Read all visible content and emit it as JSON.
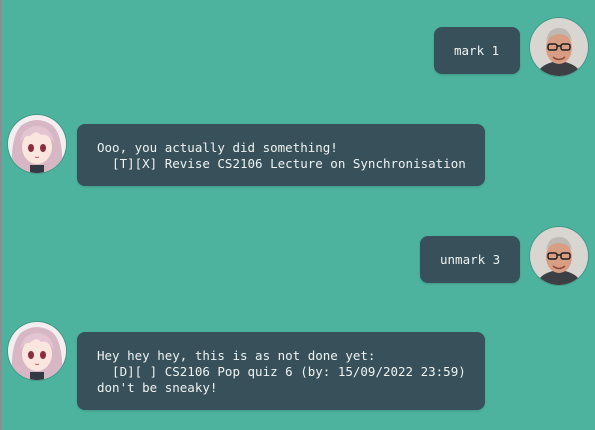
{
  "window": {
    "accent": "#4db39e",
    "bubble_color": "#37505a"
  },
  "messages": [
    {
      "sender": "user",
      "avatar": "user-avatar",
      "text": "mark 1"
    },
    {
      "sender": "bot",
      "avatar": "bot-avatar",
      "text": "Ooo, you actually did something!\n  [T][X] Revise CS2106 Lecture on Synchronisation"
    },
    {
      "sender": "user",
      "avatar": "user-avatar",
      "text": "unmark 3"
    },
    {
      "sender": "bot",
      "avatar": "bot-avatar",
      "text": "Hey hey hey, this is as not done yet:\n  [D][ ] CS2106 Pop quiz 6 (by: 15/09/2022 23:59)\ndon't be sneaky!"
    }
  ]
}
